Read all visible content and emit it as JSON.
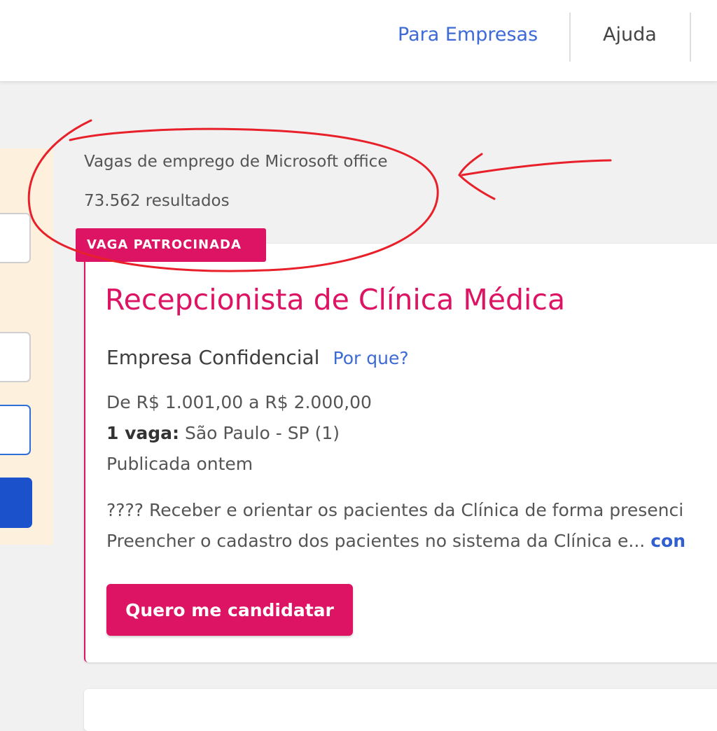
{
  "header": {
    "nav_for_companies": "Para Empresas",
    "nav_help": "Ajuda"
  },
  "results": {
    "title": "Vagas de emprego de Microsoft office",
    "count": "73.562 resultados"
  },
  "job": {
    "badge": "VAGA PATROCINADA",
    "title": "Recepcionista de Clínica Médica",
    "company": "Empresa Confidencial",
    "why_link": "Por que?",
    "salary": "De R$ 1.001,00 a R$ 2.000,00",
    "vacancy_count": "1 vaga:",
    "location": "São Paulo - SP (1)",
    "published": "Publicada ontem",
    "description_line1": "???? Receber e orientar os pacientes da Clínica de forma presenci",
    "description_line2": "Preencher o cadastro dos pacientes no sistema da Clínica e...",
    "more_link": "con",
    "apply_label": "Quero me candidatar"
  },
  "colors": {
    "brand_pink": "#dc1463",
    "link_blue": "#3d6ad6",
    "sidebar_bg": "#fdf0dd",
    "annotation_red": "#e8202a"
  },
  "annotation": {
    "shapes": [
      "ellipse-around-results",
      "arrow-pointing-left"
    ]
  }
}
